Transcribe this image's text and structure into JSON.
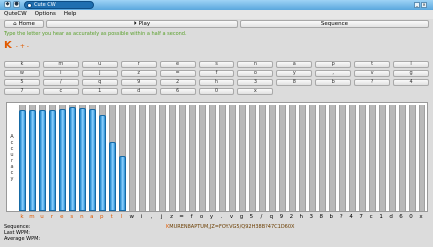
{
  "window": {
    "title": "Cute CW",
    "minimize": "_",
    "close": "×"
  },
  "menu": {
    "items": [
      "QuteCW",
      "Options",
      "Help"
    ]
  },
  "toolbar": {
    "home": "Home",
    "play": "Play",
    "sequence": "Sequence"
  },
  "instruction": "Type the letter you hear as accurately as possible within a half a second.",
  "current_key": "K",
  "typed": "- + -",
  "keyboard": [
    "k",
    "m",
    "u",
    "r",
    "e",
    "s",
    "n",
    "a",
    "p",
    "t",
    "l",
    "w",
    "i",
    "j",
    "z",
    "=",
    "f",
    "o",
    "y",
    ",",
    "v",
    "g",
    "5",
    "/",
    "q",
    "9",
    "2",
    "h",
    "3",
    "8",
    "b",
    "?",
    "4",
    "7",
    "c",
    "1",
    "d",
    "6",
    "0",
    "x"
  ],
  "chart_data": {
    "type": "bar",
    "ylabel": "Accuracy",
    "categories": [
      "k",
      "m",
      "u",
      "r",
      "e",
      "s",
      "n",
      "a",
      "p",
      "t",
      "l",
      "w",
      "i",
      ",",
      "j",
      "z",
      "=",
      "f",
      "o",
      "y",
      ".",
      "v",
      "g",
      "5",
      "/",
      "q",
      "9",
      "2",
      "h",
      "3",
      "8",
      "b",
      "?",
      "4",
      "7",
      "c",
      "1",
      "d",
      "6",
      "0",
      "x"
    ],
    "values": [
      95,
      95,
      95,
      95,
      96,
      98,
      97,
      96,
      91,
      65,
      52,
      0,
      0,
      0,
      0,
      0,
      0,
      0,
      0,
      0,
      0,
      0,
      0,
      0,
      0,
      0,
      0,
      0,
      0,
      0,
      0,
      0,
      0,
      0,
      0,
      0,
      0,
      0,
      0,
      0,
      0
    ],
    "ylim": [
      0,
      100
    ],
    "colors": {
      "learned": "#e05a00",
      "unlearned": "#000000",
      "fill": "#4aa8e8",
      "track": "#b9b9b9"
    }
  },
  "stats": {
    "sequence": "Sequence:",
    "last_wpm": "Last WPM:",
    "average_wpm": "Average WPM:"
  },
  "sequence_value": "KMUREN8APTUM,JZ=FOY.VG5/Q92H38B?47C1D60X"
}
